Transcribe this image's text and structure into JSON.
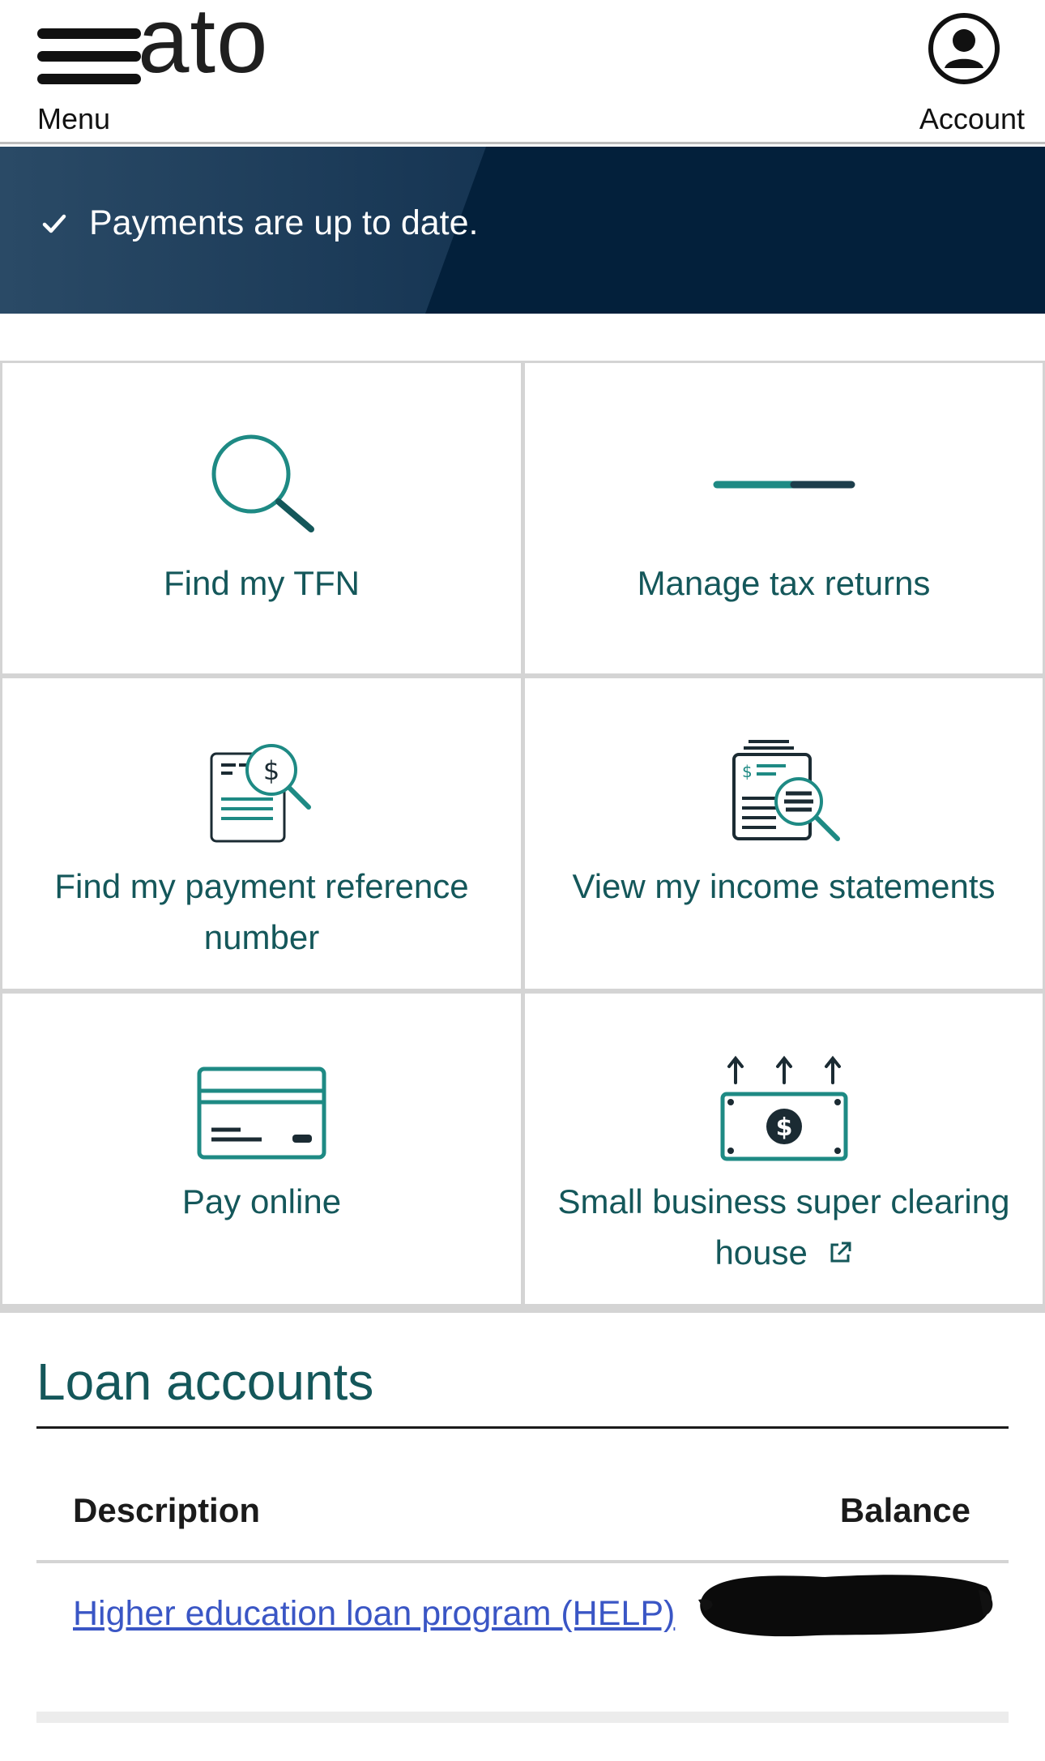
{
  "header": {
    "menu_label": "Menu",
    "logo_text": "ato",
    "account_label": "Account"
  },
  "banner": {
    "message": "Payments are up to date."
  },
  "tiles": [
    {
      "label": "Find my TFN",
      "icon": "magnifier-icon"
    },
    {
      "label": "Manage tax returns",
      "icon": "progress-bar-icon"
    },
    {
      "label": "Find my payment reference number",
      "icon": "document-search-dollar-icon"
    },
    {
      "label": "View my income statements",
      "icon": "statements-search-icon"
    },
    {
      "label": "Pay online",
      "icon": "credit-card-icon"
    },
    {
      "label": "Small business super clearing house",
      "icon": "money-upload-icon"
    }
  ],
  "loans": {
    "title": "Loan accounts",
    "col_description": "Description",
    "col_balance": "Balance",
    "rows": [
      {
        "description": "Higher education loan program (HELP)",
        "balance_redacted": true
      }
    ]
  },
  "colors": {
    "accent": "#14575a",
    "teal_icon": "#1e8a84",
    "banner_bg": "#03203b",
    "link": "#3a56c5"
  }
}
